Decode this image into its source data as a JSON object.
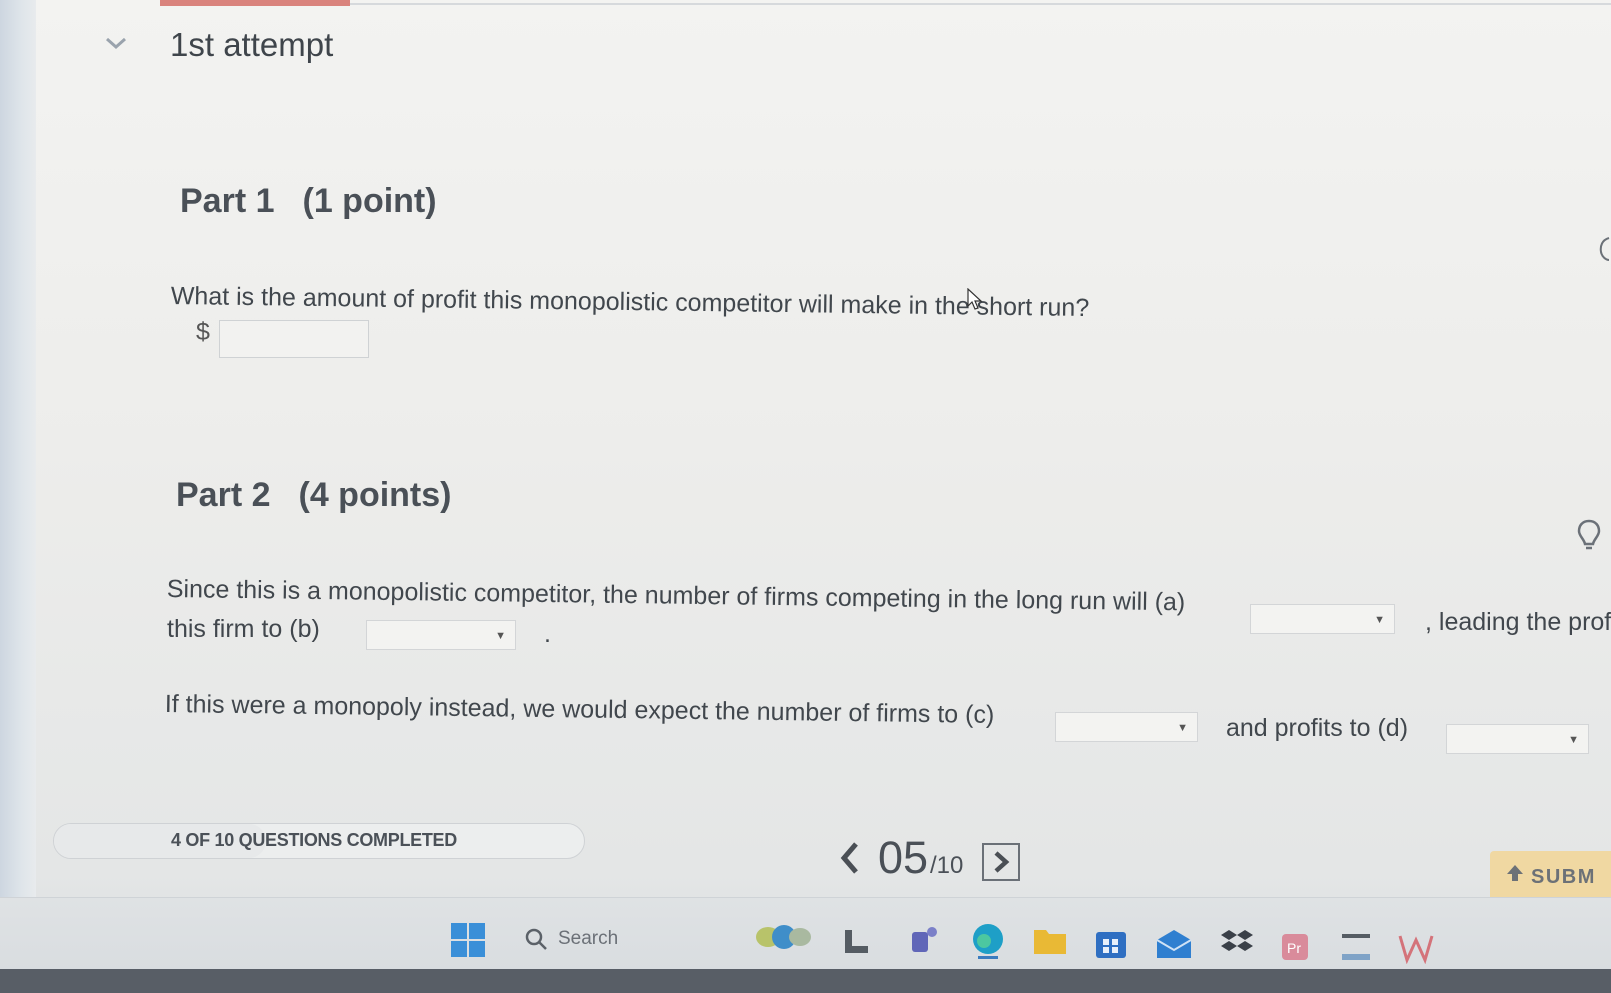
{
  "attempt": {
    "title": "1st attempt"
  },
  "part1": {
    "label": "Part 1",
    "points": "(1 point)",
    "question": "What is the amount of profit this monopolistic competitor will make in the short run?",
    "currency": "$",
    "answer_value": ""
  },
  "part2": {
    "label": "Part 2",
    "points": "(4 points)",
    "sentence1_a": "Since this is a monopolistic competitor, the number of firms competing in the long run will (a)",
    "sentence1_b": ", leading the prof",
    "sentence1_c": "this firm to (b)",
    "sentence1_end": ".",
    "sentence2_a": "If this were a monopoly instead, we would expect the number of firms to (c)",
    "sentence2_b": "and profits to (d)",
    "dropdown_a": "",
    "dropdown_b": "",
    "dropdown_c": "",
    "dropdown_d": ""
  },
  "footer": {
    "progress_text": "4 OF 10 QUESTIONS COMPLETED",
    "progress_fraction": 0.4,
    "current_page": "05",
    "total_pages": "/10",
    "submit_label": "SUBM"
  },
  "taskbar": {
    "search_label": "Search",
    "icons": [
      "windows-start-icon",
      "search-icon",
      "widgets-icon",
      "file-explorer-icon-1",
      "teams-icon",
      "edge-icon",
      "folder-icon",
      "store-icon",
      "mail-icon",
      "dropbox-icon",
      "app-icon",
      "amazon-icon",
      "word-icon"
    ]
  },
  "colors": {
    "accent_top": "#d9837d",
    "submit_bg": "#f0d8a2",
    "text": "#41474d"
  }
}
